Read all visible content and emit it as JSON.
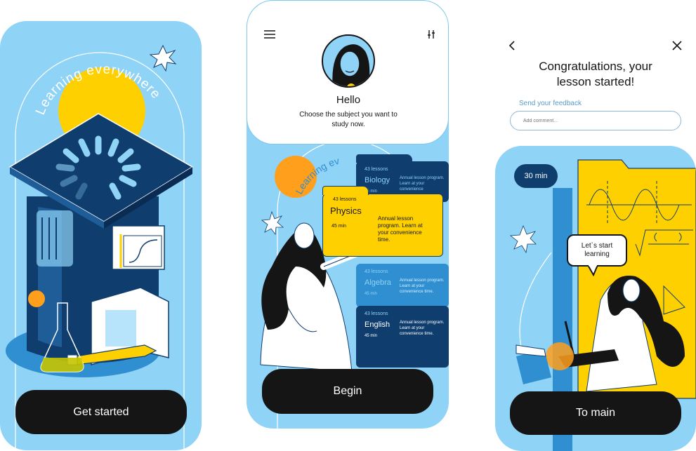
{
  "screen1": {
    "arc_text": "Learning everywhere",
    "cta_label": "Get started"
  },
  "screen2": {
    "menu_icon": "hamburger-menu-icon",
    "filter_icon": "sliders-icon",
    "greeting": "Hello",
    "prompt": "Choose the subject you want to study now.",
    "arc_text": "Learning ev",
    "cards": [
      {
        "count": "43 lessons",
        "subject": "Biology",
        "duration": "45 min",
        "description": "Annual lesson program. Learn at your convenience"
      },
      {
        "count": "43 lessons",
        "subject": "Physics",
        "duration": "45 min",
        "description": "Annual lesson program. Learn at your convenience time."
      },
      {
        "count": "43 lessons",
        "subject": "Algebra",
        "duration": "45 min",
        "description": "Annual lesson program. Learn at your convenience time."
      },
      {
        "count": "43 lessons",
        "subject": "English",
        "duration": "45 min",
        "description": "Annual lesson program. Learn at your convenience time."
      }
    ],
    "cta_label": "Begin"
  },
  "screen3": {
    "back_icon": "chevron-left-icon",
    "close_icon": "close-icon",
    "title": "Congratulations, your lesson started!",
    "feedback_label": "Send your feedback",
    "comment_placeholder": "Add comment...",
    "timer": "30 min",
    "bubble": "Let`s start learning",
    "cta_label": "To main"
  },
  "colors": {
    "sky": "#8fd3f7",
    "navy": "#0f3d6e",
    "yellow": "#ffd000",
    "black": "#151515",
    "mid_blue": "#2f8fd1"
  }
}
